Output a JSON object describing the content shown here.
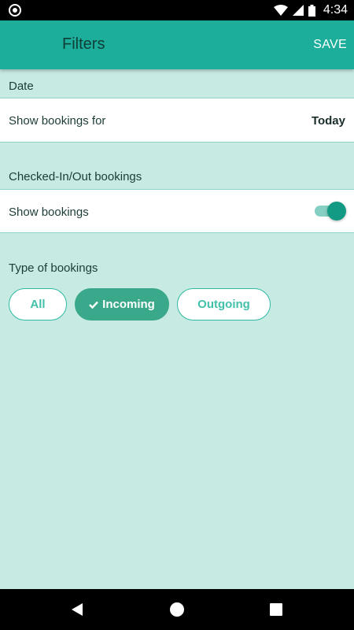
{
  "status_bar": {
    "time": "4:34"
  },
  "app_bar": {
    "title": "Filters",
    "save_label": "SAVE"
  },
  "sections": {
    "date": {
      "header": "Date",
      "row_label": "Show bookings for",
      "row_value": "Today"
    },
    "checked": {
      "header": "Checked-In/Out bookings",
      "row_label": "Show bookings",
      "toggle_on": true
    },
    "type": {
      "header": "Type of bookings",
      "chips": [
        {
          "label": "All",
          "selected": false
        },
        {
          "label": "Incoming",
          "selected": true
        },
        {
          "label": "Outgoing",
          "selected": false
        }
      ]
    }
  },
  "colors": {
    "app_bar": "#1cae9a",
    "background": "#c7ebe3",
    "accent": "#129a84",
    "chip_selected": "#3aa88a"
  },
  "icons": {
    "status": [
      "record-icon",
      "wifi-icon",
      "signal-icon",
      "battery-icon"
    ],
    "nav": [
      "back-icon",
      "home-icon",
      "recents-icon"
    ],
    "chip_check": "checkmark-icon"
  }
}
